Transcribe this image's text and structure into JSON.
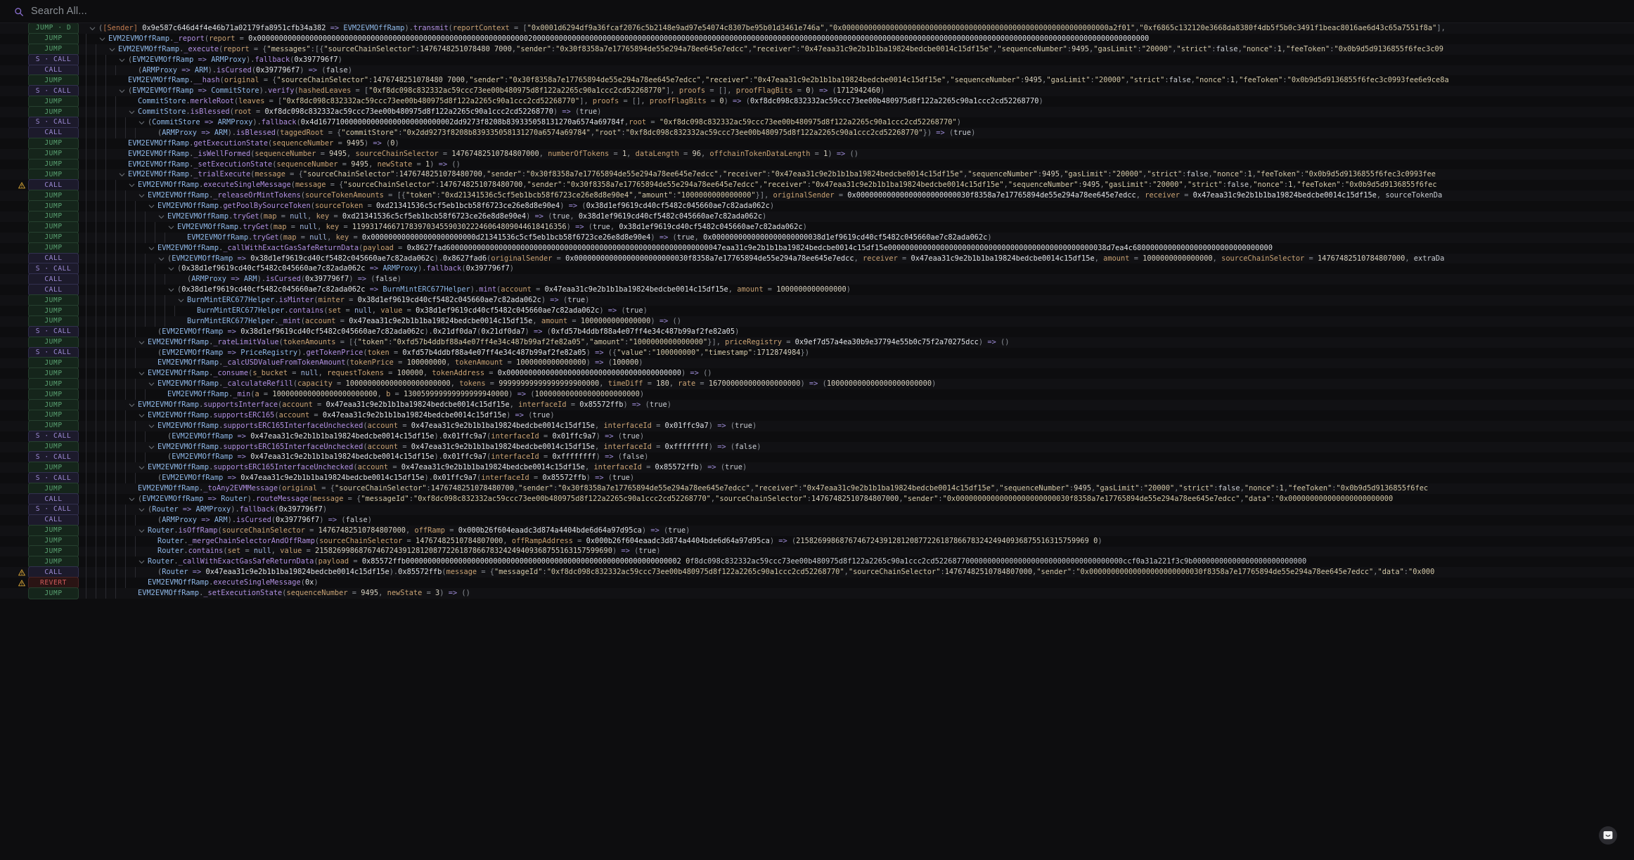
{
  "search": {
    "placeholder": "Search All...",
    "value": "",
    "icon": "search-icon",
    "icon_color": "#8a6fd1"
  },
  "colors": {
    "background": "#0d0d0f",
    "row_alt": "#111114",
    "jump_badge": "#5aa372",
    "call_badge": "#9d8bd6",
    "revert_badge": "#d05a5a",
    "warn_icon": "#d9a637",
    "contract": "#8fb8e8",
    "method": "#b08fe0",
    "param": "#c9a273",
    "string": "#d4c9a8",
    "arrow": "#9d8bd6"
  },
  "fab": {
    "name": "feedback-button",
    "icon": "chat-smile-icon"
  },
  "trace": {
    "rows": [
      {
        "badge": "JUMP · D",
        "kind": "jump",
        "warn": false,
        "indent": 0,
        "chevron": true,
        "text": "([Sender] 0x9e587c646d4f4e46b71a02179fa8951cfb34a382 => EVM2EVMOffRamp).transmit(reportContext = [\"0x0001d6294df9a36fcaf2076c5b2148e9ad97e54074c8307be95b01d3461e746a\",\"0x0000000000000000000000000000000000000000000000000000000000000a2f01\",\"0xf6865c132120e3668da8380f4db5f5b0c3491f1beac8016ae6d43c65a7551f8a\"],"
      },
      {
        "badge": "JUMP",
        "kind": "jump",
        "warn": false,
        "indent": 1,
        "chevron": true,
        "text": "EVM2EVMOffRamp._report(report = 0x000000000000000000000000000000000000000000000000000000000000002000000000000000000000000000000000000000000000000000000000000000000000000000000000000000000000000000000000000000000000000000000000000000000000"
      },
      {
        "badge": "JUMP",
        "kind": "jump",
        "warn": false,
        "indent": 2,
        "chevron": true,
        "text": "EVM2EVMOffRamp._execute(report = {\"messages\":[{\"sourceChainSelector\":1476748251078480 7000,\"sender\":\"0x30f8358a7e17765894de55e294a78ee645e7edcc\",\"receiver\":\"0x47eaa31c9e2b1b1ba19824bedcbe0014c15df15e\",\"sequenceNumber\":9495,\"gasLimit\":\"20000\",\"strict\":false,\"nonce\":1,\"feeToken\":\"0x0b9d5d9136855f6fec3c09"
      },
      {
        "badge": "S · CALL",
        "kind": "call",
        "warn": false,
        "indent": 3,
        "chevron": true,
        "text": "(EVM2EVMOffRamp => ARMProxy).fallback(0x397796f7)"
      },
      {
        "badge": "CALL",
        "kind": "call",
        "warn": false,
        "indent": 4,
        "chevron": false,
        "text": "(ARMProxy => ARM).isCursed(0x397796f7) => (false)"
      },
      {
        "badge": "JUMP",
        "kind": "jump",
        "warn": false,
        "indent": 3,
        "chevron": false,
        "text": "EVM2EVMOffRamp.__hash(original = {\"sourceChainSelector\":1476748251078480 7000,\"sender\":\"0x30f8358a7e17765894de55e294a78ee645e7edcc\",\"receiver\":\"0x47eaa31c9e2b1b1ba19824bedcbe0014c15df15e\",\"sequenceNumber\":9495,\"gasLimit\":\"20000\",\"strict\":false,\"nonce\":1,\"feeToken\":\"0x0b9d5d9136855f6fec3c0993fee6e9ce8a"
      },
      {
        "badge": "S · CALL",
        "kind": "call",
        "warn": false,
        "indent": 3,
        "chevron": true,
        "text": "(EVM2EVMOffRamp => CommitStore).verify(hashedLeaves = [\"0xf8dc098c832332ac59ccc73ee00b480975d8f122a2265c90a1ccc2cd52268770\"], proofs = [], proofFlagBits = 0) => (1712942460)"
      },
      {
        "badge": "JUMP",
        "kind": "jump",
        "warn": false,
        "indent": 4,
        "chevron": false,
        "text": "CommitStore.merkleRoot(leaves = [\"0xf8dc098c832332ac59ccc73ee00b480975d8f122a2265c90a1ccc2cd52268770\"], proofs = [], proofFlagBits = 0) => (0xf8dc098c832332ac59ccc73ee00b480975d8f122a2265c90a1ccc2cd52268770)"
      },
      {
        "badge": "JUMP",
        "kind": "jump",
        "warn": false,
        "indent": 4,
        "chevron": true,
        "text": "CommitStore.isBlessed(root = 0xf8dc098c832332ac59ccc73ee00b480975d8f122a2265c90a1ccc2cd52268770) => (true)"
      },
      {
        "badge": "S · CALL",
        "kind": "call",
        "warn": false,
        "indent": 5,
        "chevron": true,
        "text": "(CommitStore => ARMProxy).fallback(0x4d1677100000000000000000000000002dd9273f8208b839335058131270a6574a69784f,root = \"0xf8dc098c832332ac59ccc73ee00b480975d8f122a2265c90a1ccc2cd52268770\")"
      },
      {
        "badge": "CALL",
        "kind": "call",
        "warn": false,
        "indent": 6,
        "chevron": false,
        "text": "(ARMProxy => ARM).isBlessed(taggedRoot = {\"commitStore\":\"0x2dd9273f8208b839335058131270a6574a69784\",\"root\":\"0xf8dc098c832332ac59ccc73ee00b480975d8f122a2265c90a1ccc2cd52268770\"}) => (true)"
      },
      {
        "badge": "JUMP",
        "kind": "jump",
        "warn": false,
        "indent": 3,
        "chevron": false,
        "text": "EVM2EVMOffRamp.getExecutionState(sequenceNumber = 9495) => (0)"
      },
      {
        "badge": "JUMP",
        "kind": "jump",
        "warn": false,
        "indent": 3,
        "chevron": false,
        "text": "EVM2EVMOffRamp._isWellFormed(sequenceNumber = 9495, sourceChainSelector = 14767482510784807000, numberOfTokens = 1, dataLength = 96, offchainTokenDataLength = 1) => ()"
      },
      {
        "badge": "JUMP",
        "kind": "jump",
        "warn": false,
        "indent": 3,
        "chevron": false,
        "text": "EVM2EVMOffRamp._setExecutionState(sequenceNumber = 9495, newState = 1) => ()"
      },
      {
        "badge": "JUMP",
        "kind": "jump",
        "warn": false,
        "indent": 3,
        "chevron": true,
        "text": "EVM2EVMOffRamp._trialExecute(message = {\"sourceChainSelector\":1476748251078480700,\"sender\":\"0x30f8358a7e17765894de55e294a78ee645e7edcc\",\"receiver\":\"0x47eaa31c9e2b1b1ba19824bedcbe0014c15df15e\",\"sequenceNumber\":9495,\"gasLimit\":\"20000\",\"strict\":false,\"nonce\":1,\"feeToken\":\"0x0b9d5d9136855f6fec3c0993fee"
      },
      {
        "badge": "CALL",
        "kind": "call",
        "warn": true,
        "indent": 4,
        "chevron": true,
        "text": "EVM2EVMOffRamp.executeSingleMessage(message = {\"sourceChainSelector\":1476748251078480700,\"sender\":\"0x30f8358a7e17765894de55e294a78ee645e7edcc\",\"receiver\":\"0x47eaa31c9e2b1b1ba19824bedcbe0014c15df15e\",\"sequenceNumber\":9495,\"gasLimit\":\"20000\",\"strict\":false,\"nonce\":1,\"feeToken\":\"0x0b9d5d9136855f6fec"
      },
      {
        "badge": "JUMP",
        "kind": "jump",
        "warn": false,
        "indent": 5,
        "chevron": true,
        "text": "EVM2EVMOffRamp._releaseOrMintTokens(sourceTokenAmounts = [{\"token\":\"0xd21341536c5cf5eb1bcb58f6723ce26e8d8e90e4\",\"amount\":\"1000000000000000\"}], originalSender = 0x00000000000000000000000030f8358a7e17765894de55e294a78ee645e7edcc, receiver = 0x47eaa31c9e2b1b1ba19824bedcbe0014c15df15e, sourceTokenDa"
      },
      {
        "badge": "JUMP",
        "kind": "jump",
        "warn": false,
        "indent": 6,
        "chevron": true,
        "text": "EVM2EVMOffRamp.getPoolBySourceToken(sourceToken = 0xd21341536c5cf5eb1bcb58f6723ce26e8d8e90e4) => (0x38d1ef9619cd40cf5482c045660ae7c82ada062c)"
      },
      {
        "badge": "JUMP",
        "kind": "jump",
        "warn": false,
        "indent": 7,
        "chevron": true,
        "text": "EVM2EVMOffRamp.tryGet(map = null, key = 0xd21341536c5cf5eb1bcb58f6723ce26e8d8e90e4) => (true, 0x38d1ef9619cd40cf5482c045660ae7c82ada062c)"
      },
      {
        "badge": "JUMP",
        "kind": "jump",
        "warn": false,
        "indent": 8,
        "chevron": true,
        "text": "EVM2EVMOffRamp.tryGet(map = null, key = 1199317466717839703455903022246064809044618416356) => (true, 0x38d1ef9619cd40cf5482c045660ae7c82ada062c)"
      },
      {
        "badge": "JUMP",
        "kind": "jump",
        "warn": false,
        "indent": 9,
        "chevron": false,
        "text": "EVM2EVMOffRamp.tryGet(map = null, key = 0x000000000000000000000000d21341536c5cf5eb1bcb58f6723ce26e8d8e90e4) => (true, 0x0000000000000000000000038d1ef9619cd40cf5482c045660ae7c82ada062c)"
      },
      {
        "badge": "JUMP",
        "kind": "jump",
        "warn": false,
        "indent": 6,
        "chevron": true,
        "text": "EVM2EVMOffRamp._callWithExactGasSafeReturnData(payload = 0x8627fad600000000000000000000000000000000000000000000000000000000000047eaa31c9e2b1b1ba19824bedcbe0014c15df15e00000000000000000000000000000000000000000000000038d7ea4c68000000000000000000000000000000"
      },
      {
        "badge": "CALL",
        "kind": "call",
        "warn": false,
        "indent": 7,
        "chevron": true,
        "text": "(EVM2EVMOffRamp => 0x38d1ef9619cd40cf5482c045660ae7c82ada062c).0x8627fad6(originalSender = 0x00000000000000000000000030f8358a7e17765894de55e294a78ee645e7edcc, receiver = 0x47eaa31c9e2b1b1ba19824bedcbe0014c15df15e, amount = 1000000000000000, sourceChainSelector = 14767482510784807000, extraDa"
      },
      {
        "badge": "S · CALL",
        "kind": "call",
        "warn": false,
        "indent": 8,
        "chevron": true,
        "text": "(0x38d1ef9619cd40cf5482c045660ae7c82ada062c => ARMProxy).fallback(0x397796f7)"
      },
      {
        "badge": "CALL",
        "kind": "call",
        "warn": false,
        "indent": 9,
        "chevron": false,
        "text": "(ARMProxy => ARM).isCursed(0x397796f7) => (false)"
      },
      {
        "badge": "CALL",
        "kind": "call",
        "warn": false,
        "indent": 8,
        "chevron": true,
        "text": "(0x38d1ef9619cd40cf5482c045660ae7c82ada062c => BurnMintERC677Helper).mint(account = 0x47eaa31c9e2b1b1ba19824bedcbe0014c15df15e, amount = 1000000000000000)"
      },
      {
        "badge": "JUMP",
        "kind": "jump",
        "warn": false,
        "indent": 9,
        "chevron": true,
        "text": "BurnMintERC677Helper.isMinter(minter = 0x38d1ef9619cd40cf5482c045660ae7c82ada062c) => (true)"
      },
      {
        "badge": "JUMP",
        "kind": "jump",
        "warn": false,
        "indent": 10,
        "chevron": false,
        "text": "BurnMintERC677Helper.contains(set = null, value = 0x38d1ef9619cd40cf5482c045660ae7c82ada062c) => (true)"
      },
      {
        "badge": "JUMP",
        "kind": "jump",
        "warn": false,
        "indent": 9,
        "chevron": false,
        "text": "BurnMintERC677Helper._mint(account = 0x47eaa31c9e2b1b1ba19824bedcbe0014c15df15e, amount = 1000000000000000) => ()"
      },
      {
        "badge": "S · CALL",
        "kind": "call",
        "warn": false,
        "indent": 6,
        "chevron": false,
        "text": "(EVM2EVMOffRamp => 0x38d1ef9619cd40cf5482c045660ae7c82ada062c).0x21df0da7(0x21df0da7) => (0xfd57b4ddbf88a4e07ff4e34c487b99af2fe82a05)"
      },
      {
        "badge": "JUMP",
        "kind": "jump",
        "warn": false,
        "indent": 5,
        "chevron": true,
        "text": "EVM2EVMOffRamp._rateLimitValue(tokenAmounts = [{\"token\":\"0xfd57b4ddbf88a4e07ff4e34c487b99af2fe82a05\",\"amount\":\"1000000000000000\"}], priceRegistry = 0x9ef7d57a4ea30b9e37794e55b0c75f2a70275dcc) => ()"
      },
      {
        "badge": "S · CALL",
        "kind": "call",
        "warn": false,
        "indent": 6,
        "chevron": false,
        "text": "(EVM2EVMOffRamp => PriceRegistry).getTokenPrice(token = 0xfd57b4ddbf88a4e07ff4e34c487b99af2fe82a05) => ({\"value\":\"100000000\",\"timestamp\":1712874984})"
      },
      {
        "badge": "JUMP",
        "kind": "jump",
        "warn": false,
        "indent": 6,
        "chevron": false,
        "text": "EVM2EVMOffRamp._calcUSDValueFromTokenAmount(tokenPrice = 100000000, tokenAmount = 1000000000000000) => (100000)"
      },
      {
        "badge": "JUMP",
        "kind": "jump",
        "warn": false,
        "indent": 5,
        "chevron": true,
        "text": "EVM2EVMOffRamp._consume(s_bucket = null, requestTokens = 100000, tokenAddress = 0x0000000000000000000000000000000000000000) => ()"
      },
      {
        "badge": "JUMP",
        "kind": "jump",
        "warn": false,
        "indent": 6,
        "chevron": true,
        "text": "EVM2EVMOffRamp._calculateRefill(capacity = 100000000000000000000000, tokens = 99999999999999999900000, timeDiff = 180, rate = 167000000000000000000) => (100000000000000000000000)"
      },
      {
        "badge": "JUMP",
        "kind": "jump",
        "warn": false,
        "indent": 7,
        "chevron": false,
        "text": "EVM2EVMOffRamp._min(a = 100000000000000000000000, b = 130059999999999999940000) => (100000000000000000000000)"
      },
      {
        "badge": "JUMP",
        "kind": "jump",
        "warn": false,
        "indent": 4,
        "chevron": true,
        "text": "EVM2EVMOffRamp.supportsInterface(account = 0x47eaa31c9e2b1b1ba19824bedcbe0014c15df15e, interfaceId = 0x85572ffb) => (true)"
      },
      {
        "badge": "JUMP",
        "kind": "jump",
        "warn": false,
        "indent": 5,
        "chevron": true,
        "text": "EVM2EVMOffRamp.supportsERC165(account = 0x47eaa31c9e2b1b1ba19824bedcbe0014c15df15e) => (true)"
      },
      {
        "badge": "JUMP",
        "kind": "jump",
        "warn": false,
        "indent": 6,
        "chevron": true,
        "text": "EVM2EVMOffRamp.supportsERC165InterfaceUnchecked(account = 0x47eaa31c9e2b1b1ba19824bedcbe0014c15df15e, interfaceId = 0x01ffc9a7) => (true)"
      },
      {
        "badge": "S · CALL",
        "kind": "call",
        "warn": false,
        "indent": 7,
        "chevron": false,
        "text": "(EVM2EVMOffRamp => 0x47eaa31c9e2b1b1ba19824bedcbe0014c15df15e).0x01ffc9a7(interfaceId = 0x01ffc9a7) => (true)"
      },
      {
        "badge": "JUMP",
        "kind": "jump",
        "warn": false,
        "indent": 6,
        "chevron": true,
        "text": "EVM2EVMOffRamp.supportsERC165InterfaceUnchecked(account = 0x47eaa31c9e2b1b1ba19824bedcbe0014c15df15e, interfaceId = 0xffffffff) => (false)"
      },
      {
        "badge": "S · CALL",
        "kind": "call",
        "warn": false,
        "indent": 7,
        "chevron": false,
        "text": "(EVM2EVMOffRamp => 0x47eaa31c9e2b1b1ba19824bedcbe0014c15df15e).0x01ffc9a7(interfaceId = 0xffffffff) => (false)"
      },
      {
        "badge": "JUMP",
        "kind": "jump",
        "warn": false,
        "indent": 5,
        "chevron": true,
        "text": "EVM2EVMOffRamp.supportsERC165InterfaceUnchecked(account = 0x47eaa31c9e2b1b1ba19824bedcbe0014c15df15e, interfaceId = 0x85572ffb) => (true)"
      },
      {
        "badge": "S · CALL",
        "kind": "call",
        "warn": false,
        "indent": 6,
        "chevron": false,
        "text": "(EVM2EVMOffRamp => 0x47eaa31c9e2b1b1ba19824bedcbe0014c15df15e).0x01ffc9a7(interfaceId = 0x85572ffb) => (true)"
      },
      {
        "badge": "JUMP",
        "kind": "jump",
        "warn": false,
        "indent": 4,
        "chevron": false,
        "text": "EVM2EVMOffRamp._toAny2EVMMessage(original = {\"sourceChainSelector\":1476748251078480700,\"sender\":\"0x30f8358a7e17765894de55e294a78ee645e7edcc\",\"receiver\":\"0x47eaa31c9e2b1b1ba19824bedcbe0014c15df15e\",\"sequenceNumber\":9495,\"gasLimit\":\"20000\",\"strict\":false,\"nonce\":1,\"feeToken\":\"0x0b9d5d9136855f6fec"
      },
      {
        "badge": "CALL",
        "kind": "call",
        "warn": false,
        "indent": 4,
        "chevron": true,
        "text": "(EVM2EVMOffRamp => Router).routeMessage(message = {\"messageId\":\"0xf8dc098c832332ac59ccc73ee00b480975d8f122a2265c90a1ccc2cd52268770\",\"sourceChainSelector\":14767482510784807000,\"sender\":\"0x00000000000000000000000030f8358a7e17765894de55e294a78ee645e7edcc\",\"data\":\"0x000000000000000000000000"
      },
      {
        "badge": "S · CALL",
        "kind": "call",
        "warn": false,
        "indent": 5,
        "chevron": true,
        "text": "(Router => ARMProxy).fallback(0x397796f7)"
      },
      {
        "badge": "CALL",
        "kind": "call",
        "warn": false,
        "indent": 6,
        "chevron": false,
        "text": "(ARMProxy => ARM).isCursed(0x397796f7) => (false)"
      },
      {
        "badge": "JUMP",
        "kind": "jump",
        "warn": false,
        "indent": 5,
        "chevron": true,
        "text": "Router.isOffRamp(sourceChainSelector = 14767482510784807000, offRamp = 0x000b26f604eaadc3d874a4404bde6d64a97d95ca) => (true)"
      },
      {
        "badge": "JUMP",
        "kind": "jump",
        "warn": false,
        "indent": 6,
        "chevron": false,
        "text": "Router._mergeChainSelectorAndOffRamp(sourceChainSelector = 14767482510784807000, offRampAddress = 0x000b26f604eaadc3d874a4404bde6d64a97d95ca) => (2158269986876746724391281208772261878667832424940936875516315759969 0)"
      },
      {
        "badge": "JUMP",
        "kind": "jump",
        "warn": false,
        "indent": 6,
        "chevron": false,
        "text": "Router.contains(set = null, value = 21582699868767467243912812087722618786678324249409368755163157599690) => (true)"
      },
      {
        "badge": "JUMP",
        "kind": "jump",
        "warn": false,
        "indent": 5,
        "chevron": true,
        "text": "Router._callWithExactGasSafeReturnData(payload = 0x85572ffb000000000000000000000000000000000000000000000000000000000000002 0f8dc098c832332ac59ccc73ee00b480975d8f122a2265c90a1ccc2cd5226877000000000000000000000000000000000000ccf0a31a221f3c9b00000000000000000000000000"
      },
      {
        "badge": "CALL",
        "kind": "call",
        "warn": true,
        "indent": 6,
        "chevron": false,
        "text": "(Router => 0x47eaa31c9e2b1b1ba19824bedcbe0014c15df15e).0x85572ffb(message = {\"messageId\":\"0xf8dc098c832332ac59ccc73ee00b480975d8f122a2265c90a1ccc2cd52268770\",\"sourceChainSelector\":14767482510784807000,\"sender\":\"0x00000000000000000000000030f8358a7e17765894de55e294a78ee645e7edcc\",\"data\":\"0x000"
      },
      {
        "badge": "REVERT",
        "kind": "revert",
        "warn": true,
        "indent": 5,
        "chevron": false,
        "text": "EVM2EVMOffRamp.executeSingleMessage(0x)"
      },
      {
        "badge": "JUMP",
        "kind": "jump",
        "warn": false,
        "indent": 4,
        "chevron": false,
        "text": "EVM2EVMOffRamp._setExecutionState(sequenceNumber = 9495, newState = 3) => ()"
      }
    ]
  }
}
